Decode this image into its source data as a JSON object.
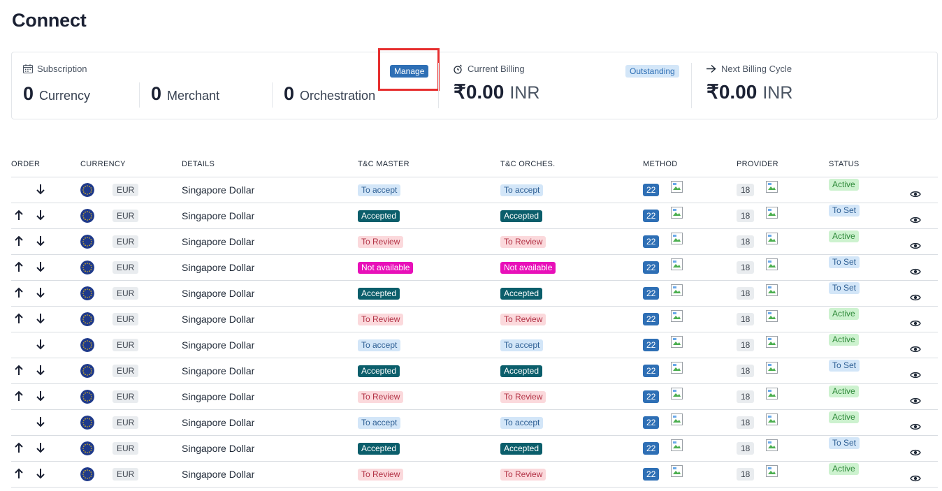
{
  "page": {
    "title": "Connect"
  },
  "subscription": {
    "label": "Subscription",
    "icon": "calendar-icon",
    "manage_label": "Manage",
    "stats": [
      {
        "value": "0",
        "label": "Currency"
      },
      {
        "value": "0",
        "label": "Merchant"
      },
      {
        "value": "0",
        "label": "Orchestration"
      }
    ]
  },
  "current_billing": {
    "label": "Current Billing",
    "icon": "alarm-clock-icon",
    "badge": "Outstanding",
    "amount": "₹0.00",
    "currency": "INR"
  },
  "next_billing": {
    "label": "Next Billing Cycle",
    "icon": "arrow-right-icon",
    "amount": "₹0.00",
    "currency": "INR"
  },
  "table": {
    "columns": [
      "ORDER",
      "CURRENCY",
      "DETAILS",
      "T&C MASTER",
      "T&C ORCHES.",
      "METHOD",
      "PROVIDER",
      "STATUS"
    ],
    "rows": [
      {
        "up": false,
        "code": "EUR",
        "details": "Singapore Dollar",
        "master": "To accept",
        "orches": "To accept",
        "method": "22",
        "provider": "18",
        "status": "Active"
      },
      {
        "up": true,
        "code": "EUR",
        "details": "Singapore Dollar",
        "master": "Accepted",
        "orches": "Accepted",
        "method": "22",
        "provider": "18",
        "status": "To Set"
      },
      {
        "up": true,
        "code": "EUR",
        "details": "Singapore Dollar",
        "master": "To Review",
        "orches": "To Review",
        "method": "22",
        "provider": "18",
        "status": "Active"
      },
      {
        "up": true,
        "code": "EUR",
        "details": "Singapore Dollar",
        "master": "Not available",
        "orches": "Not available",
        "method": "22",
        "provider": "18",
        "status": "To Set"
      },
      {
        "up": true,
        "code": "EUR",
        "details": "Singapore Dollar",
        "master": "Accepted",
        "orches": "Accepted",
        "method": "22",
        "provider": "18",
        "status": "To Set"
      },
      {
        "up": true,
        "code": "EUR",
        "details": "Singapore Dollar",
        "master": "To Review",
        "orches": "To Review",
        "method": "22",
        "provider": "18",
        "status": "Active"
      },
      {
        "up": false,
        "code": "EUR",
        "details": "Singapore Dollar",
        "master": "To accept",
        "orches": "To accept",
        "method": "22",
        "provider": "18",
        "status": "Active"
      },
      {
        "up": true,
        "code": "EUR",
        "details": "Singapore Dollar",
        "master": "Accepted",
        "orches": "Accepted",
        "method": "22",
        "provider": "18",
        "status": "To Set"
      },
      {
        "up": true,
        "code": "EUR",
        "details": "Singapore Dollar",
        "master": "To Review",
        "orches": "To Review",
        "method": "22",
        "provider": "18",
        "status": "Active"
      },
      {
        "up": false,
        "code": "EUR",
        "details": "Singapore Dollar",
        "master": "To accept",
        "orches": "To accept",
        "method": "22",
        "provider": "18",
        "status": "Active"
      },
      {
        "up": true,
        "code": "EUR",
        "details": "Singapore Dollar",
        "master": "Accepted",
        "orches": "Accepted",
        "method": "22",
        "provider": "18",
        "status": "To Set"
      },
      {
        "up": true,
        "code": "EUR",
        "details": "Singapore Dollar",
        "master": "To Review",
        "orches": "To Review",
        "method": "22",
        "provider": "18",
        "status": "Active"
      }
    ]
  },
  "colors": {
    "primary": "#2e6fb5",
    "accepted": "#0b5e6b",
    "not_available": "#e810b9",
    "review_bg": "#fbd9dc",
    "active_bg": "#cdf2cf",
    "highlight": "#e62e2e"
  }
}
